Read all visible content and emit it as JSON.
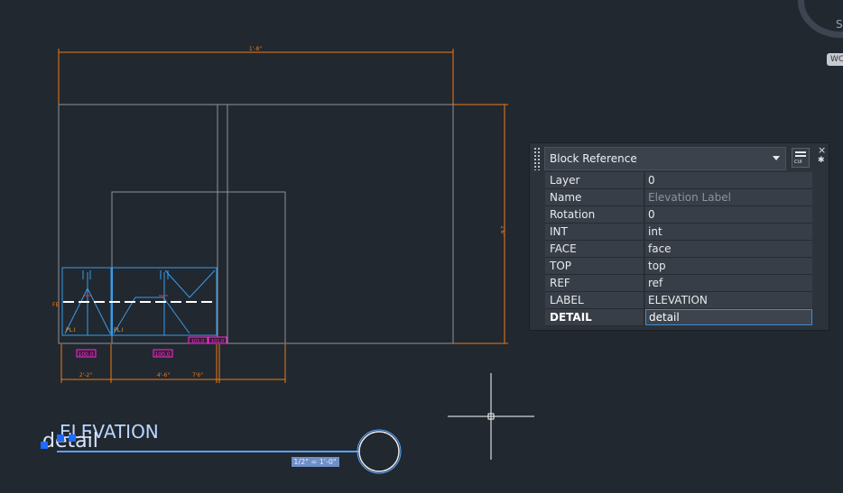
{
  "drawing": {
    "dim_top": "1'-8\"",
    "dim_right": "1'6\"",
    "dim_bottom_1": "2'-2\"",
    "dim_bottom_2": "4'-6\"",
    "dim_bottom_3": "7'6\"",
    "fe_label": "FE",
    "cab_label_1": "PL.I",
    "cab_label_2": "PL.I",
    "tag_1": "100.0",
    "tag_2": "100.0",
    "tag_3": "101.0",
    "tag_4": "101.0",
    "elevation_text": "ELEVATION",
    "detail_text": "detail",
    "scale_text": "1/2\" = 1'-0\""
  },
  "viewcube": {
    "wcs_label": "WCS",
    "s_glyph": "S"
  },
  "palette": {
    "object_type": "Block Reference",
    "close_glyph": "×",
    "gear_glyph": "✱",
    "cui_label": "CUI",
    "properties": [
      {
        "key": "Layer",
        "value": "0"
      },
      {
        "key": "Name",
        "value": "Elevation Label"
      },
      {
        "key": "Rotation",
        "value": "0"
      },
      {
        "key": "INT",
        "value": "int"
      },
      {
        "key": "FACE",
        "value": "face"
      },
      {
        "key": "TOP",
        "value": "top"
      },
      {
        "key": "REF",
        "value": "ref"
      },
      {
        "key": "LABEL",
        "value": "ELEVATION"
      },
      {
        "key": "DETAIL",
        "value": "detail"
      }
    ]
  },
  "colors": {
    "background": "#212830",
    "outline": "#8d949c",
    "dimension": "#f07a14",
    "cabinet": "#3a9be8",
    "tag": "#ff2ad4",
    "selection": "#5aa5ff"
  }
}
